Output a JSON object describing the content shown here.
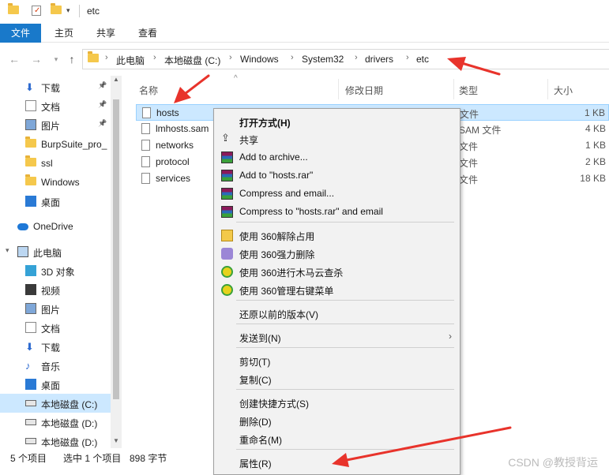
{
  "window": {
    "title": "etc"
  },
  "ribbon": {
    "tabs": [
      "文件",
      "主页",
      "共享",
      "查看"
    ]
  },
  "address": {
    "crumbs": [
      "此电脑",
      "本地磁盘 (C:)",
      "Windows",
      "System32",
      "drivers",
      "etc"
    ]
  },
  "sidebar": {
    "items": [
      {
        "label": "下载",
        "icon": "download-icon",
        "pinned": true
      },
      {
        "label": "文档",
        "icon": "document-icon",
        "pinned": true
      },
      {
        "label": "图片",
        "icon": "pictures-icon",
        "pinned": true
      },
      {
        "label": "BurpSuite_pro_",
        "icon": "folder-icon"
      },
      {
        "label": "ssl",
        "icon": "folder-icon"
      },
      {
        "label": "Windows",
        "icon": "folder-icon"
      },
      {
        "label": "桌面",
        "icon": "desktop-icon"
      },
      {
        "label": "OneDrive",
        "icon": "cloud-icon"
      },
      {
        "label": "此电脑",
        "icon": "computer-icon"
      },
      {
        "label": "3D 对象",
        "icon": "3d-objects-icon"
      },
      {
        "label": "视频",
        "icon": "video-icon"
      },
      {
        "label": "图片",
        "icon": "pictures-icon"
      },
      {
        "label": "文档",
        "icon": "document-icon"
      },
      {
        "label": "下载",
        "icon": "download-icon"
      },
      {
        "label": "音乐",
        "icon": "music-icon"
      },
      {
        "label": "桌面",
        "icon": "desktop-icon"
      },
      {
        "label": "本地磁盘 (C:)",
        "icon": "drive-icon",
        "selected": true
      },
      {
        "label": "本地磁盘 (D:)",
        "icon": "drive-icon"
      },
      {
        "label": "本地磁盘 (D:)",
        "icon": "drive-icon"
      }
    ]
  },
  "columns": {
    "name": "名称",
    "modified": "修改日期",
    "type": "类型",
    "size": "大小"
  },
  "files": [
    {
      "name": "hosts",
      "type": "文件",
      "size": "1 KB",
      "selected": true
    },
    {
      "name": "lmhosts.sam",
      "type": "SAM 文件",
      "size": "4 KB"
    },
    {
      "name": "networks",
      "type": "文件",
      "size": "1 KB"
    },
    {
      "name": "protocol",
      "type": "文件",
      "size": "2 KB"
    },
    {
      "name": "services",
      "type": "文件",
      "size": "18 KB"
    }
  ],
  "status": {
    "count": "5 个项目",
    "selection": "选中 1 个项目",
    "size": "898 字节"
  },
  "context_menu": {
    "items": [
      {
        "label": "打开方式(H)",
        "bold": true
      },
      {
        "label": "共享",
        "icon": "share-icon"
      },
      {
        "label": "Add to archive...",
        "icon": "winrar-icon"
      },
      {
        "label": "Add to \"hosts.rar\"",
        "icon": "winrar-icon"
      },
      {
        "label": "Compress and email...",
        "icon": "winrar-icon"
      },
      {
        "label": "Compress to \"hosts.rar\" and email",
        "icon": "winrar-icon"
      },
      {
        "label": "使用 360解除占用",
        "icon": "360-unlock-icon"
      },
      {
        "label": "使用 360强力删除",
        "icon": "360-delete-icon"
      },
      {
        "label": "使用 360进行木马云查杀",
        "icon": "360-scan-icon"
      },
      {
        "label": "使用 360管理右键菜单",
        "icon": "360-menu-icon"
      },
      {
        "label": "还原以前的版本(V)"
      },
      {
        "label": "发送到(N)",
        "submenu": true
      },
      {
        "label": "剪切(T)"
      },
      {
        "label": "复制(C)"
      },
      {
        "label": "创建快捷方式(S)"
      },
      {
        "label": "删除(D)"
      },
      {
        "label": "重命名(M)"
      },
      {
        "label": "属性(R)"
      }
    ]
  },
  "watermark": "CSDN @教授背运",
  "colors": {
    "accent": "#1979ca",
    "selection": "#cce8ff",
    "annotation": "#e8332b"
  }
}
